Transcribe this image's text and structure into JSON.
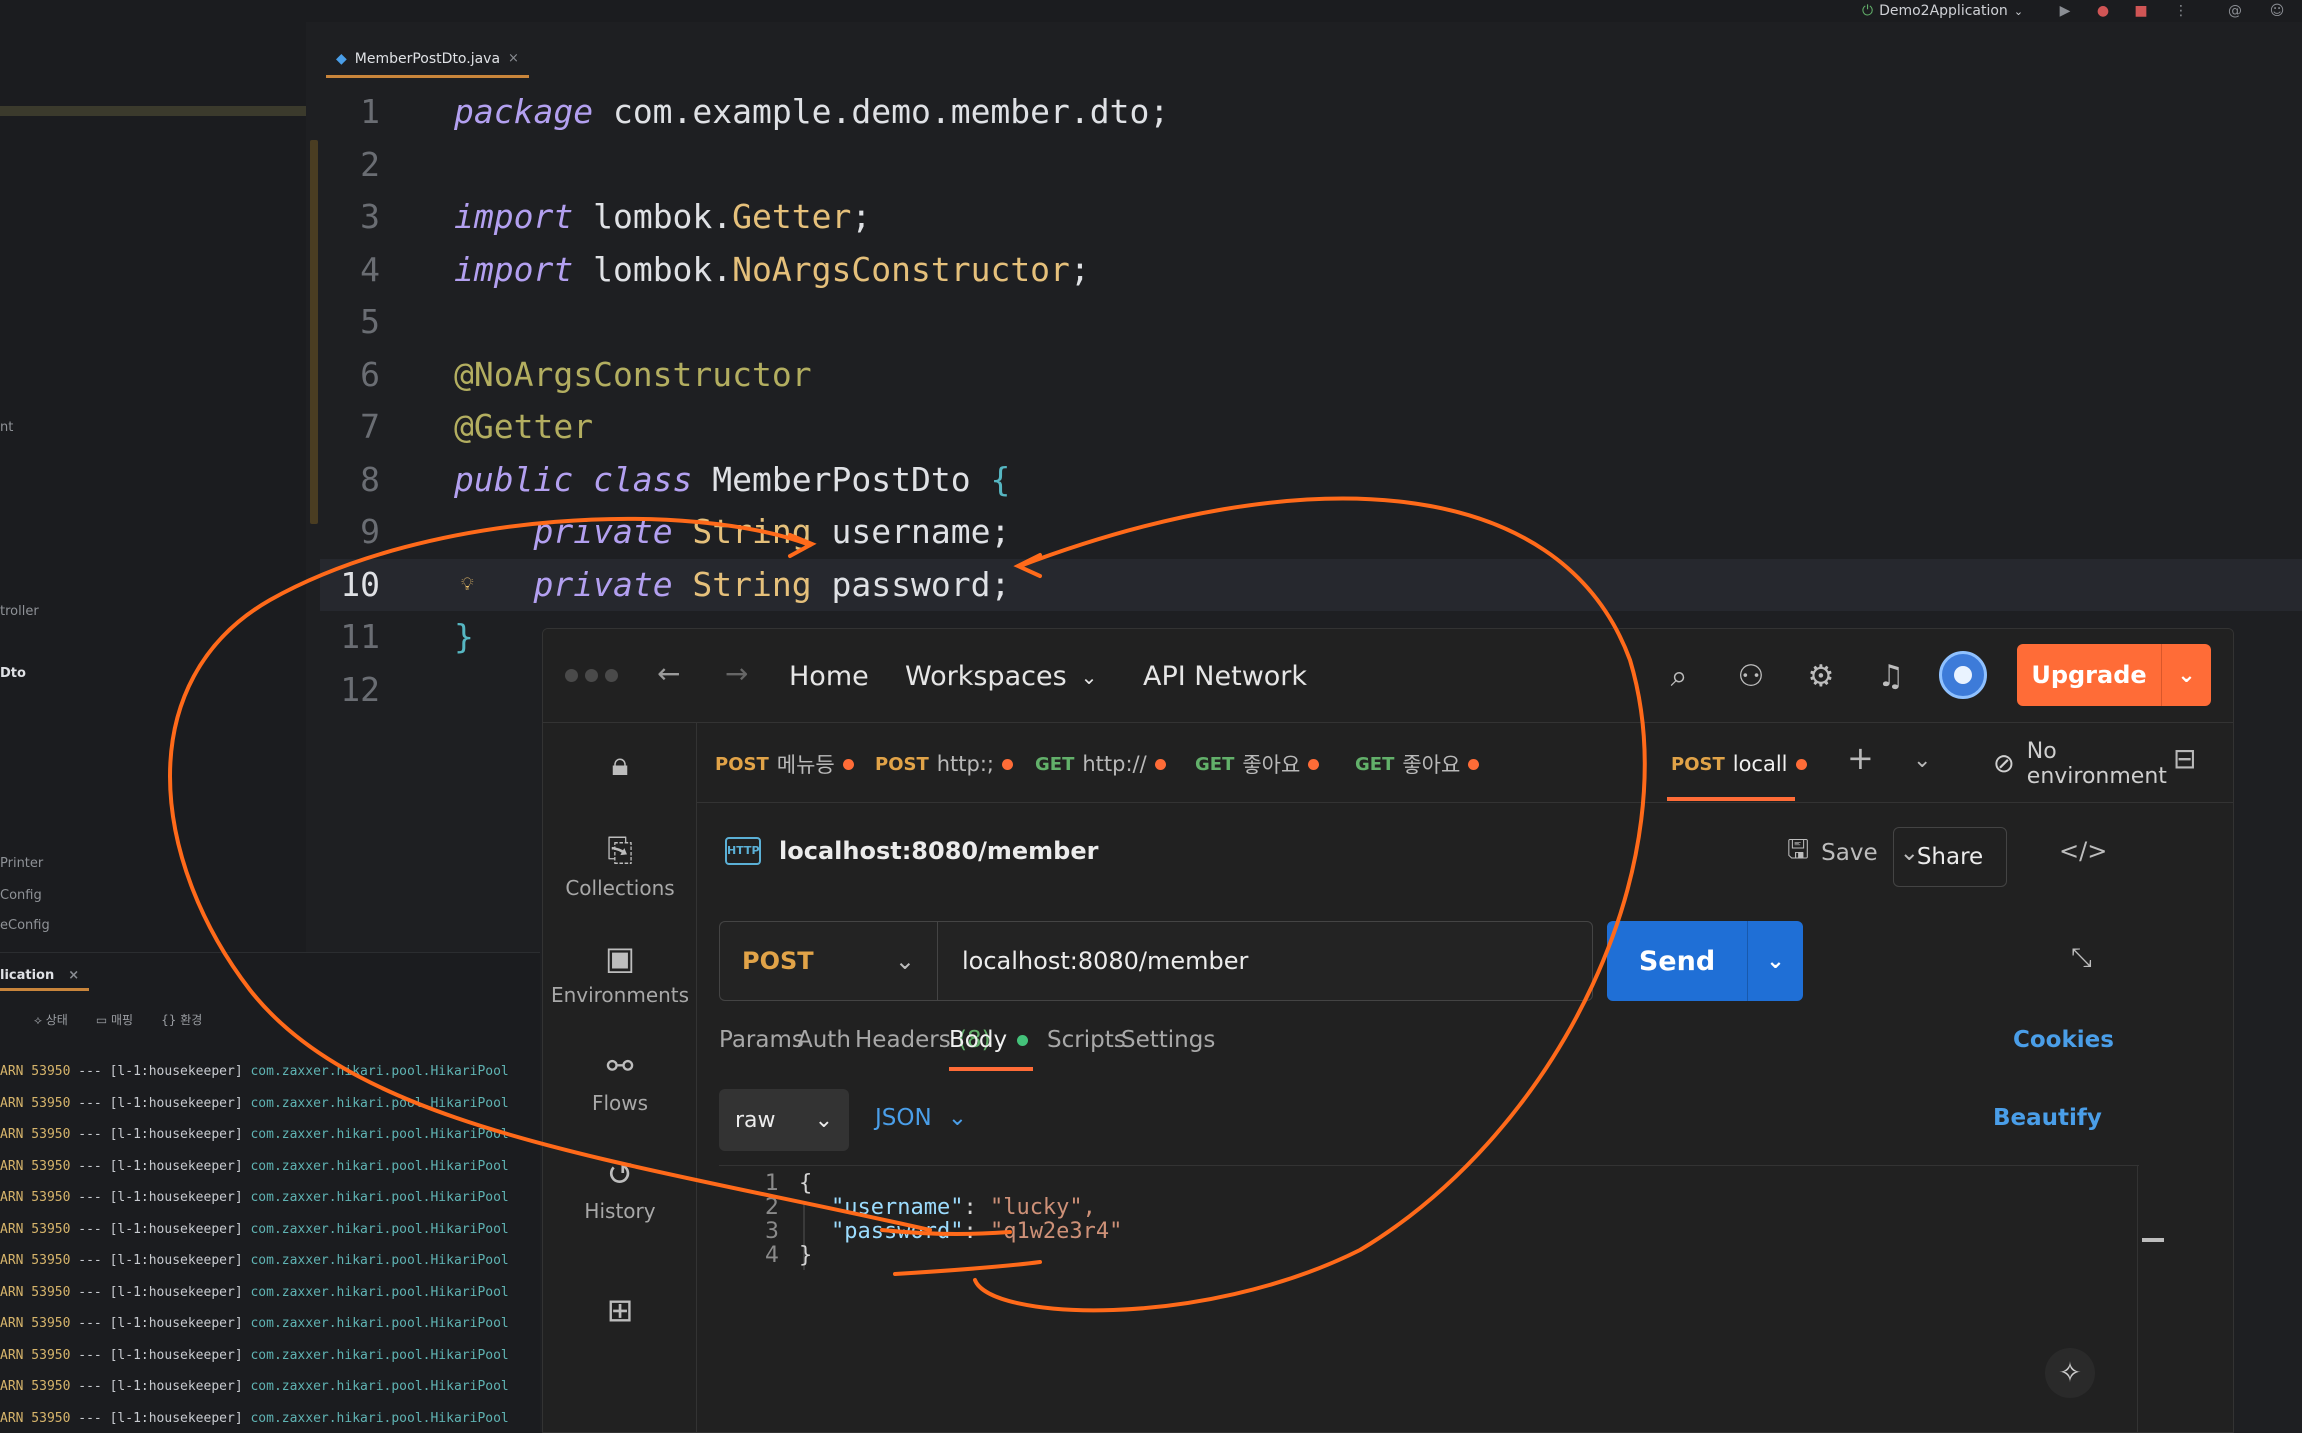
{
  "ide": {
    "run_config": "Demo2Application",
    "editor_tab": "MemberPostDto.java",
    "project_items": [
      "nt",
      "troller",
      "Dto",
      "Printer",
      "Config",
      "eConfig"
    ],
    "code_lines": [
      {
        "n": "1",
        "parts": [
          [
            "kw2",
            "package"
          ],
          [
            "pkg",
            " com.example.demo.member.dto;"
          ]
        ]
      },
      {
        "n": "2",
        "parts": []
      },
      {
        "n": "3",
        "parts": [
          [
            "kw2",
            "import"
          ],
          [
            "pkg",
            " lombok."
          ],
          [
            "type",
            "Getter"
          ],
          [
            "pkg",
            ";"
          ]
        ]
      },
      {
        "n": "4",
        "parts": [
          [
            "kw2",
            "import"
          ],
          [
            "pkg",
            " lombok."
          ],
          [
            "type",
            "NoArgsConstructor"
          ],
          [
            "pkg",
            ";"
          ]
        ]
      },
      {
        "n": "5",
        "parts": []
      },
      {
        "n": "6",
        "parts": [
          [
            "ann",
            "@NoArgsConstructor"
          ]
        ]
      },
      {
        "n": "7",
        "parts": [
          [
            "ann",
            "@Getter"
          ]
        ]
      },
      {
        "n": "8",
        "parts": [
          [
            "kw2",
            "public class"
          ],
          [
            "pkg",
            " MemberPostDto "
          ],
          [
            "brace",
            "{"
          ]
        ]
      },
      {
        "n": "9",
        "parts": [
          [
            "pkg",
            "    "
          ],
          [
            "kw2",
            "private"
          ],
          [
            "type",
            " String"
          ],
          [
            "pkg",
            " username;"
          ]
        ]
      },
      {
        "n": "10",
        "parts": [
          [
            "pkg",
            "    "
          ],
          [
            "kw2",
            "private"
          ],
          [
            "type",
            " String"
          ],
          [
            "pkg",
            " password;"
          ]
        ]
      },
      {
        "n": "11",
        "parts": [
          [
            "brace",
            "}"
          ]
        ]
      },
      {
        "n": "12",
        "parts": []
      }
    ],
    "run_panel": {
      "tab": "lication",
      "toolbar": [
        "상태",
        "매핑",
        "환경"
      ],
      "log_level": "ARN",
      "log_pid": "53950",
      "log_thread": "--- [l-1:housekeeper]",
      "log_class": "com.zaxxer.hikari.pool.HikariPool",
      "log_count": 12
    }
  },
  "postman": {
    "nav": {
      "home": "Home",
      "workspaces": "Workspaces",
      "api_network": "API Network"
    },
    "upgrade": "Upgrade",
    "sidebar": [
      "Collections",
      "Environments",
      "Flows",
      "History"
    ],
    "tabs": [
      {
        "method": "POST",
        "label": "메뉴등"
      },
      {
        "method": "POST",
        "label": "http:;"
      },
      {
        "method": "GET",
        "label": "http://"
      },
      {
        "method": "GET",
        "label": "좋아요"
      },
      {
        "method": "GET",
        "label": "좋아요"
      },
      {
        "method": "POST",
        "label": "locall"
      }
    ],
    "environment": "No environment",
    "request_name": "localhost:8080/member",
    "http_badge": "HTTP",
    "save": "Save",
    "share": "Share",
    "method": "POST",
    "url": "localhost:8080/member",
    "send": "Send",
    "param_tabs": {
      "params": "Params",
      "auth": "Auth",
      "headers": "Headers",
      "headers_count": "(8)",
      "body": "Body",
      "scripts": "Scripts",
      "settings": "Settings"
    },
    "cookies": "Cookies",
    "body_mode": "raw",
    "body_lang": "JSON",
    "beautify": "Beautify",
    "body_lines": [
      {
        "n": "1",
        "text": "{"
      },
      {
        "n": "2",
        "key": "\"username\"",
        "val": "\"lucky\","
      },
      {
        "n": "3",
        "key": "\"password\"",
        "val": "\"q1w2e3r4\""
      },
      {
        "n": "4",
        "text": "}"
      }
    ],
    "colors": {
      "accent": "#ff6c37",
      "send": "#1f6fd6",
      "link": "#4a9ee8"
    }
  }
}
